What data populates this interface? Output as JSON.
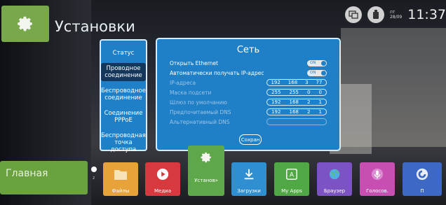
{
  "header": {
    "title": "Установки",
    "date_day": "пт",
    "date": "28/09",
    "time": "11:37"
  },
  "side_menu": {
    "items": [
      {
        "label": "Статус",
        "active": false
      },
      {
        "label": "Проводное соединение",
        "active": true
      },
      {
        "label": "Беспроводное соединение",
        "active": false
      },
      {
        "label": "Соединение PPPoE",
        "active": false
      },
      {
        "label": "Беспроводная точка доступа",
        "active": false
      }
    ]
  },
  "network_panel": {
    "title": "Сеть",
    "open_ethernet": {
      "label": "Открыть Ethernet",
      "state": "ON"
    },
    "auto_ip": {
      "label": "Автоматически получать IP-адрес",
      "state": "ON"
    },
    "fields": [
      {
        "label": "IP-адреса",
        "octets": [
          "192",
          "168",
          "3",
          "77"
        ]
      },
      {
        "label": "Маска подсети",
        "octets": [
          "255",
          "255",
          "0",
          "0"
        ]
      },
      {
        "label": "Шлюз по умолчанию",
        "octets": [
          "192",
          "168",
          "2",
          "1"
        ]
      },
      {
        "label": "Предпочитаемый DNS",
        "octets": [
          "192",
          "168",
          "2",
          "1"
        ]
      },
      {
        "label": "Альтернативный DNS",
        "octets": [
          "",
          "",
          "",
          ""
        ]
      }
    ],
    "save_label": "Сохран"
  },
  "dock": {
    "home_label": "Главная",
    "notification_count": "2",
    "apps": [
      {
        "label": "Файлы",
        "icon": "folder-icon",
        "color": "#e7a23a"
      },
      {
        "label": "Медиа",
        "icon": "play-icon",
        "color": "#d8393e"
      },
      {
        "label": "Установ»",
        "icon": "gear-icon",
        "color": "#5fa84a"
      },
      {
        "label": "Загрузки",
        "icon": "download-icon",
        "color": "#2f8fd0"
      },
      {
        "label": "My Apps",
        "icon": "apps-icon",
        "color": "#4fa844"
      },
      {
        "label": "Браузер",
        "icon": "globe-icon",
        "color": "#7b53c3"
      },
      {
        "label": "Голосов.",
        "icon": "microphone-icon",
        "color": "#c84fb2"
      },
      {
        "label": "П",
        "icon": "assistant-icon",
        "color": "#3d68c4"
      }
    ]
  },
  "colors": {
    "panel_blue": "#1f80c8",
    "settings_green": "#78a84b"
  }
}
